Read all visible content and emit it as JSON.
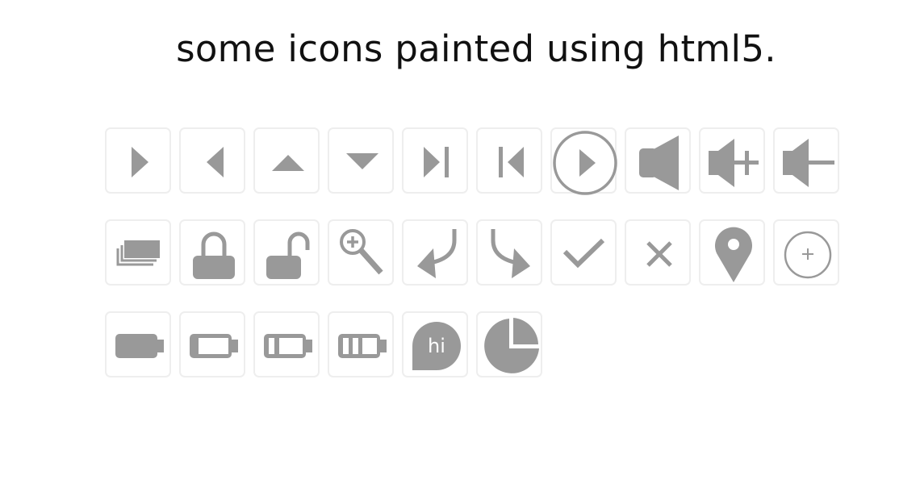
{
  "header": {
    "title": "some icons painted using html5."
  },
  "colors": {
    "icon": "#999999",
    "tile_border": "#eeeeee",
    "title": "#111111"
  },
  "icons": {
    "hi_bubble_text": "hi"
  }
}
